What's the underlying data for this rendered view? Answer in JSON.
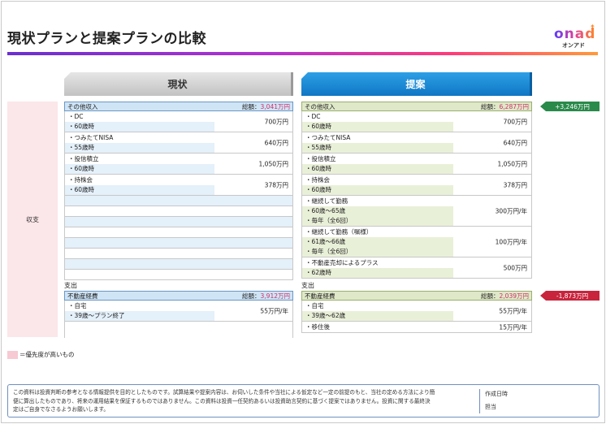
{
  "title": "現状プランと提案プランの比較",
  "logo": {
    "word": "onad",
    "sub": "オンアド"
  },
  "columns": {
    "current": "現状",
    "proposed": "提案"
  },
  "side_label": "収支",
  "current": {
    "income": {
      "label": "その他収入",
      "total_label": "総額：",
      "total_value": "3,041万円",
      "rows": [
        {
          "lines": [
            "・DC",
            "・60歳時"
          ],
          "amount": "700万円"
        },
        {
          "lines": [
            "・つみたてNISA",
            "・55歳時"
          ],
          "amount": "640万円"
        },
        {
          "lines": [
            "・投信積立",
            "・60歳時"
          ],
          "amount": "1,050万円"
        },
        {
          "lines": [
            "・持株会",
            "・60歳時"
          ],
          "amount": "378万円"
        }
      ]
    },
    "expense_section": "支出",
    "expense": {
      "label": "不動産経費",
      "total_label": "総額：",
      "total_value": "3,912万円",
      "rows": [
        {
          "lines": [
            "・自宅",
            "・39歳～プラン終了"
          ],
          "amount": "55万円/年"
        }
      ]
    }
  },
  "proposed": {
    "income": {
      "label": "その他収入",
      "total_label": "総額：",
      "total_value": "6,287万円",
      "rows": [
        {
          "lines": [
            "・DC",
            "・60歳時"
          ],
          "amount": "700万円"
        },
        {
          "lines": [
            "・つみたてNISA",
            "・55歳時"
          ],
          "amount": "640万円"
        },
        {
          "lines": [
            "・投信積立",
            "・60歳時"
          ],
          "amount": "1,050万円"
        },
        {
          "lines": [
            "・持株会",
            "・60歳時"
          ],
          "amount": "378万円"
        },
        {
          "lines": [
            "・継続して勤務",
            "・60歳～65歳",
            "・毎年（全6回）"
          ],
          "amount": "300万円/年"
        },
        {
          "lines": [
            "・継続して勤務（嘱様）",
            "・61歳～66歳",
            "・毎年（全6回）"
          ],
          "amount": "100万円/年"
        },
        {
          "lines": [
            "・不動産売却によるプラス",
            "・62歳時"
          ],
          "amount": "500万円"
        }
      ]
    },
    "expense_section": "支出",
    "expense": {
      "label": "不動産経費",
      "total_label": "総額：",
      "total_value": "2,039万円",
      "rows": [
        {
          "lines": [
            "・自宅",
            "・39歳～62歳"
          ],
          "amount": "55万円/年"
        },
        {
          "lines": [
            "・移住後"
          ],
          "amount": "15万円/年"
        }
      ]
    }
  },
  "diffs": {
    "income": "+3,246万円",
    "expense": "-1,873万円"
  },
  "legend": "＝優先度が高いもの",
  "footer": {
    "disclaimer": "この資料は投資判断の参考となる情報提供を目的としたものです。試算結果や提案内容は、お伺いした条件や当社による仮定など一定の前提のもと、当社の定める方法により簡便に算出したものであり、将来の運用結果を保証するものではありません。この資料は投資一任契約あるいは投資助言契約に基づく提案ではありません。投資に関する最終決定はご自身でなさるようお願いします。",
    "created_label": "作成日時",
    "owner_label": "担当"
  },
  "colors": {
    "accent_gradient": [
      "#6a2fd0",
      "#ff3a7a",
      "#ff9a3a"
    ],
    "current_header": "#c2c2c2",
    "proposed_header": "#0f76c4",
    "plus": "#2a8a4a",
    "minus": "#c8243c",
    "priority": "#f7c9d3"
  }
}
